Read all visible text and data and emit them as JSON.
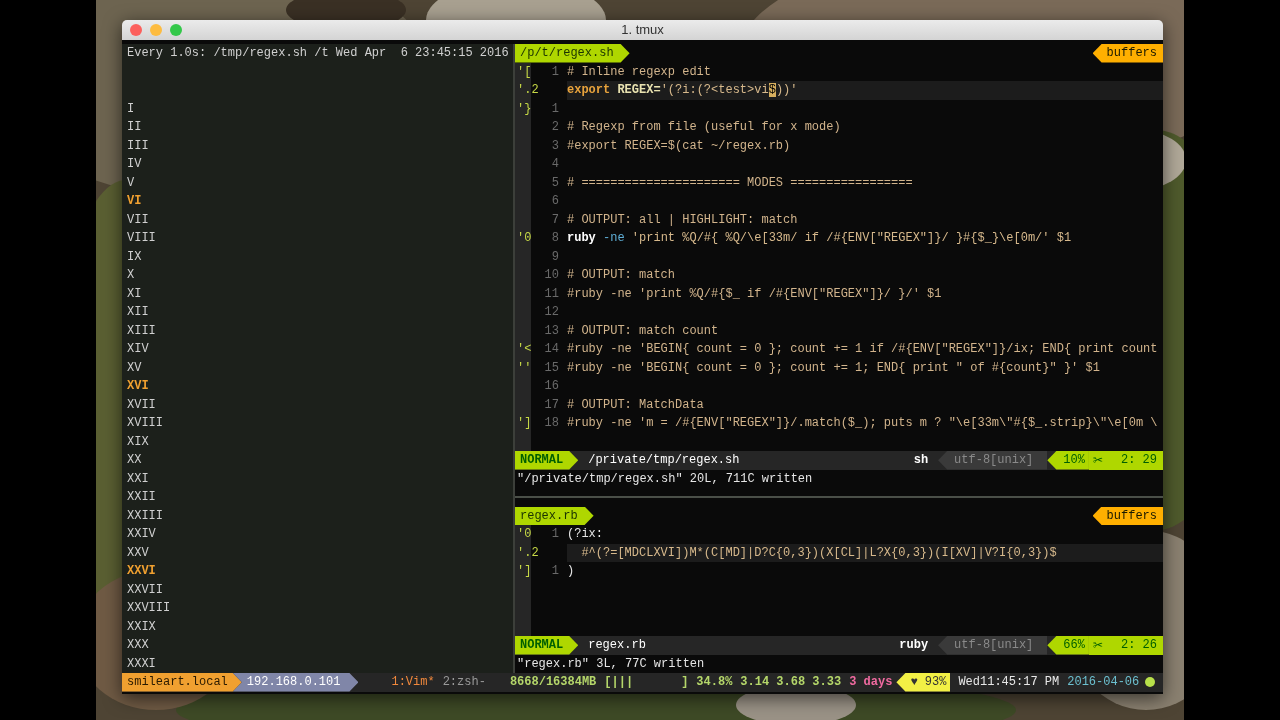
{
  "window": {
    "title": "1. tmux"
  },
  "watch_pane": {
    "header": "Every 1.0s: /tmp/regex.sh /t Wed Apr  6 23:45:15 2016",
    "lines": [
      {
        "text": "I",
        "highlighted": false
      },
      {
        "text": "II",
        "highlighted": false
      },
      {
        "text": "III",
        "highlighted": false
      },
      {
        "text": "IV",
        "highlighted": false
      },
      {
        "text": "V",
        "highlighted": false
      },
      {
        "text": "VI",
        "highlighted": true
      },
      {
        "text": "VII",
        "highlighted": false
      },
      {
        "text": "VIII",
        "highlighted": false
      },
      {
        "text": "IX",
        "highlighted": false
      },
      {
        "text": "X",
        "highlighted": false
      },
      {
        "text": "XI",
        "highlighted": false
      },
      {
        "text": "XII",
        "highlighted": false
      },
      {
        "text": "XIII",
        "highlighted": false
      },
      {
        "text": "XIV",
        "highlighted": false
      },
      {
        "text": "XV",
        "highlighted": false
      },
      {
        "text": "XVI",
        "highlighted": true
      },
      {
        "text": "XVII",
        "highlighted": false
      },
      {
        "text": "XVIII",
        "highlighted": false
      },
      {
        "text": "XIX",
        "highlighted": false
      },
      {
        "text": "XX",
        "highlighted": false
      },
      {
        "text": "XXI",
        "highlighted": false
      },
      {
        "text": "XXII",
        "highlighted": false
      },
      {
        "text": "XXIII",
        "highlighted": false
      },
      {
        "text": "XXIV",
        "highlighted": false
      },
      {
        "text": "XXV",
        "highlighted": false
      },
      {
        "text": "XXVI",
        "highlighted": true
      },
      {
        "text": "XXVII",
        "highlighted": false
      },
      {
        "text": "XXVIII",
        "highlighted": false
      },
      {
        "text": "XXIX",
        "highlighted": false
      },
      {
        "text": "XXX",
        "highlighted": false
      },
      {
        "text": "XXXI",
        "highlighted": false
      }
    ]
  },
  "editor_panes": [
    {
      "tab": "/p/t/regex.sh",
      "buffers_label": "buffers",
      "lines": [
        {
          "mark": "'[",
          "number": "1",
          "current": false,
          "segments": [
            {
              "kind": "comment",
              "text": "# Inline regexp edit"
            }
          ]
        },
        {
          "mark": "'.2",
          "current": true,
          "segments": [
            {
              "kind": "keyword",
              "text": "export"
            },
            {
              "kind": "variable",
              "text": " REGEX="
            },
            {
              "kind": "string",
              "text": "'(?i:(?<test>vi"
            },
            {
              "kind": "cursor",
              "text": "$"
            },
            {
              "kind": "string",
              "text": "))'"
            }
          ]
        },
        {
          "mark": "'}",
          "number": "1",
          "current": false
        },
        {
          "number": "2",
          "current": false,
          "segments": [
            {
              "kind": "comment",
              "text": "# Regexp from file (useful for x mode)"
            }
          ]
        },
        {
          "number": "3",
          "current": false,
          "segments": [
            {
              "kind": "comment",
              "text": "#export REGEX=$(cat ~/regex.rb)"
            }
          ]
        },
        {
          "number": "4",
          "current": false
        },
        {
          "number": "5",
          "current": false,
          "segments": [
            {
              "kind": "comment",
              "text": "# ====================== MODES ================="
            }
          ]
        },
        {
          "number": "6",
          "current": false
        },
        {
          "number": "7",
          "current": false,
          "segments": [
            {
              "kind": "comment",
              "text": "# OUTPUT: all | HIGHLIGHT: match"
            }
          ]
        },
        {
          "mark": "'0",
          "number": "8",
          "current": false,
          "segments": [
            {
              "kind": "command",
              "text": "ruby"
            },
            {
              "kind": "option",
              "text": " -ne"
            },
            {
              "kind": "string",
              "text": " 'print %Q/#{ %Q/\\e[33m/ if /#{ENV[\"REGEX\"]}/ }#{$_}\\e[0m/' $1"
            }
          ]
        },
        {
          "number": "9",
          "current": false
        },
        {
          "number": "10",
          "current": false,
          "segments": [
            {
              "kind": "comment",
              "text": "# OUTPUT: match"
            }
          ]
        },
        {
          "number": "11",
          "current": false,
          "segments": [
            {
              "kind": "comment",
              "text": "#ruby -ne 'print %Q/#{$_ if /#{ENV[\"REGEX\"]}/ }/' $1"
            }
          ]
        },
        {
          "number": "12",
          "current": false
        },
        {
          "number": "13",
          "current": false,
          "segments": [
            {
              "kind": "comment",
              "text": "# OUTPUT: match count"
            }
          ]
        },
        {
          "mark": "'<",
          "number": "14",
          "current": false,
          "segments": [
            {
              "kind": "comment",
              "text": "#ruby -ne 'BEGIN{ count = 0 }; count += 1 if /#{ENV[\"REGEX\"]}/ix; END{ print count"
            }
          ]
        },
        {
          "mark": "''",
          "number": "15",
          "current": false,
          "segments": [
            {
              "kind": "comment",
              "text": "#ruby -ne 'BEGIN{ count = 0 }; count += 1; END{ print \" of #{count}\" }' $1"
            }
          ]
        },
        {
          "number": "16",
          "current": false
        },
        {
          "number": "17",
          "current": false,
          "segments": [
            {
              "kind": "comment",
              "text": "# OUTPUT: MatchData"
            }
          ]
        },
        {
          "mark": "']",
          "number": "18",
          "current": false,
          "segments": [
            {
              "kind": "comment",
              "text": "#ruby -ne 'm = /#{ENV[\"REGEX\"]}/.match($_); puts m ? \"\\e[33m\\\"#{$_.strip}\\\"\\e[0m \\"
            }
          ]
        }
      ],
      "status": {
        "mode": "NORMAL",
        "file": "/private/tmp/regex.sh",
        "filetype": "sh",
        "encoding": "utf-8[unix]",
        "percent": "10%",
        "scissors": "✂",
        "position": "2: 29"
      },
      "message": "\"/private/tmp/regex.sh\" 20L, 711C written"
    },
    {
      "tab": "regex.rb",
      "buffers_label": "buffers",
      "lines": [
        {
          "mark": "'0",
          "number": "1",
          "current": false,
          "segments": [
            {
              "kind": "plain",
              "text": "(?ix:"
            }
          ]
        },
        {
          "mark": "'.2",
          "current": true,
          "segments": [
            {
              "kind": "string",
              "text": "  #^(?=[MDCLXVI])M*(C[MD]|D?C{0,3})(X[CL]|L?X{0,3})(I[XV]|V?I{0,3})$"
            }
          ]
        },
        {
          "mark": "']",
          "number": "1",
          "current": false,
          "segments": [
            {
              "kind": "plain",
              "text": ")"
            }
          ]
        }
      ],
      "status": {
        "mode": "NORMAL",
        "file": "regex.rb",
        "filetype": "ruby",
        "encoding": "utf-8[unix]",
        "percent": "66%",
        "scissors": "✂",
        "position": "2: 26"
      },
      "message": "\"regex.rb\" 3L, 77C written"
    }
  ],
  "tmux_status": {
    "host": "smileart.local",
    "ip": "192.168.0.101",
    "windows": [
      {
        "label": "1:Vim*",
        "selected": true
      },
      {
        "label": "2:zsh-",
        "selected": false
      }
    ],
    "memory": "8668/16384MB",
    "memory_bar_start": "[|||",
    "memory_bar_end": "]",
    "cpu": "34.8%",
    "load": "3.14 3.68 3.33",
    "uptime": "3 days",
    "battery": "♥ 93%",
    "time": "Wed11:45:17 PM",
    "date": "2016-04-06"
  }
}
